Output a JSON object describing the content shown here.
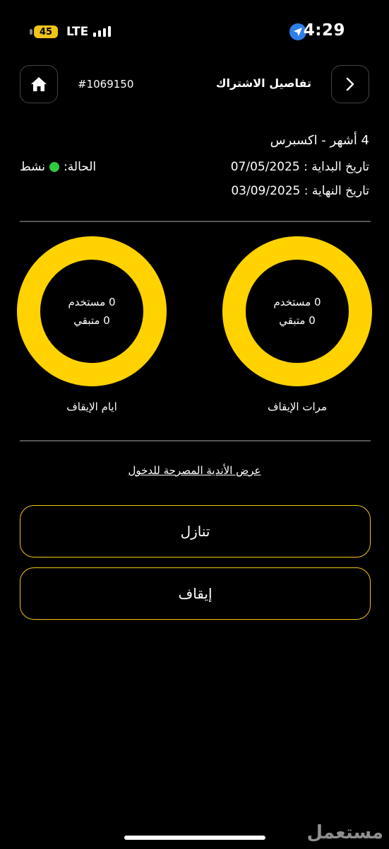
{
  "status_bar": {
    "time": "4:29",
    "battery": "45",
    "network": "LTE"
  },
  "header": {
    "title": "تفاصيل الاشتراك",
    "subscription_id": "#1069150"
  },
  "subscription": {
    "plan": "4 أشهر - اكسبرس",
    "start_date": "تاريخ البداية : 07/05/2025",
    "end_date": "تاريخ النهاية : 03/09/2025",
    "status_label": "الحالة:",
    "status_value": "نشط",
    "status_color": "#2ecc40"
  },
  "freeze": {
    "freeze_count": {
      "used": "0 مستخدم",
      "remaining": "0 متبقي",
      "label": "مرات الإيقاف"
    },
    "freeze_days": {
      "used": "0 مستخدم",
      "remaining": "0 متبقي",
      "label": "ايام الإيقاف"
    }
  },
  "clubs_link": "عرض الأندية المصرحة للدخول",
  "buttons": {
    "transfer": "تنازل",
    "freeze": "إيقاف"
  },
  "accent_color": "#ffd200",
  "watermark": "مستعمل"
}
